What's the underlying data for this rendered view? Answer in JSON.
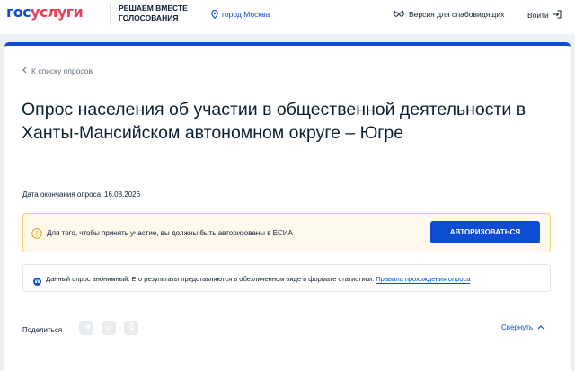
{
  "header": {
    "logo_part1": "гос",
    "logo_part2": "услуги",
    "slogan_line1": "РЕШАЕМ ВМЕСТЕ",
    "slogan_line2": "ГОЛОСОВАНИЯ",
    "city": "город Москва",
    "accessibility": "Версия для слабовидящих",
    "login": "Войти"
  },
  "survey": {
    "back_link": "К списку опросов",
    "title": "Опрос населения об участии в общественной деятельности в Ханты-Мансийском автономном округе – Югре",
    "end_date_label": "Дата окончания опроса",
    "end_date_value": "16.08.2026",
    "warning_text": "Для того, чтобы принять участие, вы должны быть авторизованы в ЕСИА",
    "auth_button": "АВТОРИЗОВАТЬСЯ",
    "info_text": "Данный опрос анонимный. Его результаты представляются в обезличенном виде в формате статистики.",
    "info_link": "Правила прохождения опроса"
  },
  "share": {
    "label": "Поделиться",
    "buttons": [
      {
        "icon": "telegram-icon",
        "glyph": ""
      },
      {
        "icon": "vk-icon",
        "glyph": "vk"
      },
      {
        "icon": "odnoklassniki-icon",
        "glyph": ""
      }
    ],
    "collapse": "Свернуть"
  },
  "colors": {
    "brand_blue": "#0d4cd3",
    "brand_red": "#ee3f58",
    "warning_bg": "#fef9ec",
    "warning_border": "#f5ce72",
    "page_bg": "#edf1f6"
  }
}
